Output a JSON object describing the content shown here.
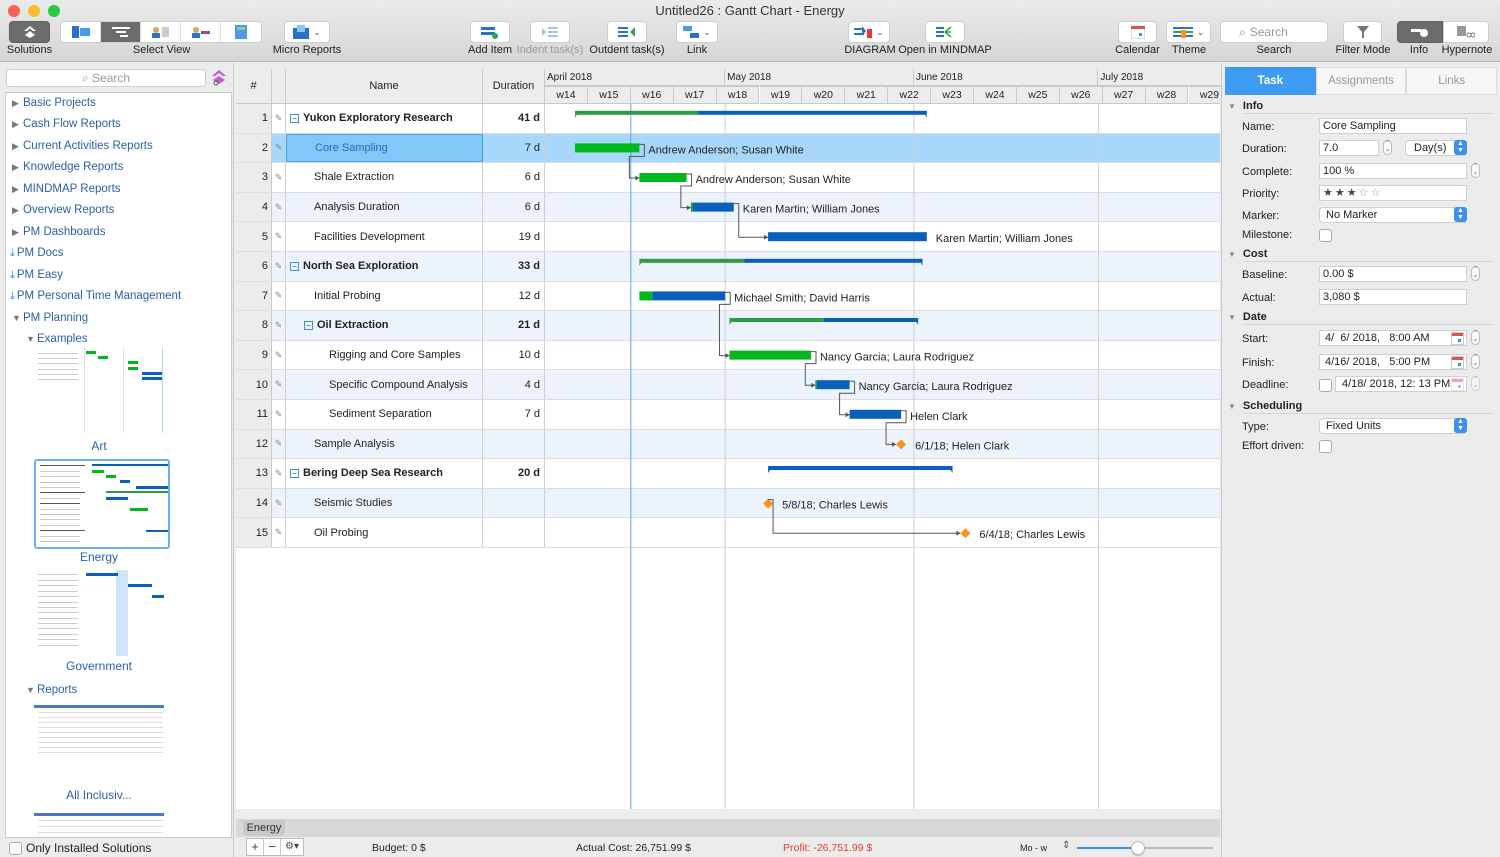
{
  "window": {
    "title": "Untitled26 : Gantt Chart - Energy"
  },
  "toolbar": {
    "solutions": "Solutions",
    "select_view": "Select View",
    "micro_reports": "Micro Reports",
    "add_item": "Add Item",
    "indent": "Indent task(s)",
    "outdent": "Outdent task(s)",
    "link": "Link",
    "diagram": "DIAGRAM",
    "open_mindmap": "Open in MINDMAP",
    "calendar": "Calendar",
    "theme": "Theme",
    "search_placeholder": "Search",
    "search_label": "Search",
    "filter_mode": "Filter Mode",
    "info": "Info",
    "hypernote": "Hypernote"
  },
  "sidebar": {
    "search_placeholder": "Search",
    "items": [
      {
        "label": "Basic Projects",
        "kind": "collapsed"
      },
      {
        "label": "Cash Flow Reports",
        "kind": "collapsed"
      },
      {
        "label": "Current Activities Reports",
        "kind": "collapsed"
      },
      {
        "label": "Knowledge Reports",
        "kind": "collapsed"
      },
      {
        "label": "MINDMAP Reports",
        "kind": "collapsed"
      },
      {
        "label": "Overview Reports",
        "kind": "collapsed"
      },
      {
        "label": "PM Dashboards",
        "kind": "collapsed"
      },
      {
        "label": "PM Docs",
        "kind": "download"
      },
      {
        "label": "PM Easy",
        "kind": "download"
      },
      {
        "label": "PM Personal Time Management",
        "kind": "download"
      },
      {
        "label": "PM Planning",
        "kind": "expanded"
      }
    ],
    "examples_label": "Examples",
    "reports_label": "Reports",
    "thumbnails": [
      "Art",
      "Energy",
      "Government"
    ],
    "report_thumbnails": [
      "All Inclusiv..."
    ],
    "only_installed": "Only Installed Solutions"
  },
  "grid": {
    "headers": {
      "num": "#",
      "name": "Name",
      "duration": "Duration"
    },
    "months": [
      "April 2018",
      "May 2018",
      "June 2018",
      "July 2018"
    ],
    "weeks": [
      "w14",
      "w15",
      "w16",
      "w17",
      "w18",
      "w19",
      "w20",
      "w21",
      "w22",
      "w23",
      "w24",
      "w25",
      "w26",
      "w27",
      "w28",
      "w29"
    ],
    "rows": [
      {
        "num": "1",
        "name": "Yukon Exploratory  Research",
        "duration": "41 d",
        "level": 0,
        "group": true
      },
      {
        "num": "2",
        "name": "Core Sampling",
        "duration": "7 d",
        "level": 1,
        "selected": true
      },
      {
        "num": "3",
        "name": "Shale Extraction",
        "duration": "6 d",
        "level": 1
      },
      {
        "num": "4",
        "name": "Analysis Duration",
        "duration": "6 d",
        "level": 1
      },
      {
        "num": "5",
        "name": "Facilities Development",
        "duration": "19 d",
        "level": 1
      },
      {
        "num": "6",
        "name": "North Sea Exploration",
        "duration": "33 d",
        "level": 0,
        "group": true
      },
      {
        "num": "7",
        "name": "Initial Probing",
        "duration": "12 d",
        "level": 1
      },
      {
        "num": "8",
        "name": "Oil  Extraction",
        "duration": "21 d",
        "level": 1,
        "group": true
      },
      {
        "num": "9",
        "name": "Rigging and Core Samples",
        "duration": "10 d",
        "level": 2
      },
      {
        "num": "10",
        "name": "Specific Compound Analysis",
        "duration": "4 d",
        "level": 2
      },
      {
        "num": "11",
        "name": "Sediment Separation",
        "duration": "7 d",
        "level": 2
      },
      {
        "num": "12",
        "name": "Sample Analysis",
        "duration": "",
        "level": 1
      },
      {
        "num": "13",
        "name": "Bering Deep Sea Research",
        "duration": "20 d",
        "level": 0,
        "group": true
      },
      {
        "num": "14",
        "name": "Seismic Studies",
        "duration": "",
        "level": 1
      },
      {
        "num": "15",
        "name": "Oil Probing",
        "duration": "",
        "level": 1
      }
    ]
  },
  "chart_data": {
    "type": "gantt",
    "x_unit": "week",
    "x_range": [
      "w14",
      "w29"
    ],
    "today_week": 16.0,
    "bars": [
      {
        "row": 1,
        "kind": "summary",
        "start": 14.7,
        "end": 22.9,
        "progress": 0.35,
        "label": ""
      },
      {
        "row": 2,
        "kind": "task",
        "start": 14.7,
        "end": 16.2,
        "progress": 1.0,
        "label": "Andrew Anderson; Susan White"
      },
      {
        "row": 3,
        "kind": "task",
        "start": 16.2,
        "end": 17.3,
        "progress": 1.0,
        "label": "Andrew Anderson; Susan White"
      },
      {
        "row": 4,
        "kind": "task",
        "start": 17.4,
        "end": 18.4,
        "progress": 0.05,
        "label": "Karen Martin; William Jones"
      },
      {
        "row": 5,
        "kind": "task",
        "start": 19.2,
        "end": 22.9,
        "progress": 0.0,
        "label": "Karen Martin; William Jones"
      },
      {
        "row": 6,
        "kind": "summary",
        "start": 16.2,
        "end": 22.8,
        "progress": 0.37,
        "label": ""
      },
      {
        "row": 7,
        "kind": "task",
        "start": 16.2,
        "end": 18.2,
        "progress": 0.15,
        "label": "Michael Smith; David Harris"
      },
      {
        "row": 8,
        "kind": "summary",
        "start": 18.3,
        "end": 22.7,
        "progress": 0.5,
        "label": ""
      },
      {
        "row": 9,
        "kind": "task",
        "start": 18.3,
        "end": 20.2,
        "progress": 1.0,
        "label": "Nancy Garcia; Laura Rodriguez"
      },
      {
        "row": 10,
        "kind": "task",
        "start": 20.3,
        "end": 21.1,
        "progress": 0.05,
        "label": "Nancy Garcia; Laura Rodriguez"
      },
      {
        "row": 11,
        "kind": "task",
        "start": 21.1,
        "end": 22.3,
        "progress": 0.0,
        "label": "Helen Clark"
      },
      {
        "row": 12,
        "kind": "milestone",
        "start": 22.3,
        "end": 22.3,
        "label": "6/1/18; Helen Clark"
      },
      {
        "row": 13,
        "kind": "summary",
        "start": 19.2,
        "end": 23.5,
        "progress": 0.0,
        "label": ""
      },
      {
        "row": 14,
        "kind": "milestone",
        "start": 19.2,
        "end": 19.2,
        "label": "5/8/18; Charles Lewis"
      },
      {
        "row": 15,
        "kind": "milestone",
        "start": 23.8,
        "end": 23.8,
        "label": "6/4/18; Charles Lewis"
      }
    ],
    "links": [
      [
        2,
        3
      ],
      [
        3,
        4
      ],
      [
        4,
        5
      ],
      [
        7,
        9
      ],
      [
        9,
        10
      ],
      [
        10,
        11
      ],
      [
        11,
        12
      ],
      [
        14,
        15
      ]
    ]
  },
  "panel": {
    "tabs": [
      "Task",
      "Assignments",
      "Links"
    ],
    "active_tab": "Task",
    "info": {
      "title": "Info",
      "name_label": "Name:",
      "name_value": "Core Sampling",
      "duration_label": "Duration:",
      "duration_value": "7.0",
      "duration_unit": "Day(s)",
      "complete_label": "Complete:",
      "complete_value": "100 %",
      "priority_label": "Priority:",
      "priority_stars": 3,
      "priority_max": 5,
      "marker_label": "Marker:",
      "marker_value": "No Marker",
      "milestone_label": "Milestone:",
      "milestone_checked": false
    },
    "cost": {
      "title": "Cost",
      "baseline_label": "Baseline:",
      "baseline_value": "0.00 $",
      "actual_label": "Actual:",
      "actual_value": "3,080 $"
    },
    "date": {
      "title": "Date",
      "start_label": "Start:",
      "start_value": "4/  6/ 2018,   8:00 AM",
      "finish_label": "Finish:",
      "finish_value": "4/16/ 2018,   5:00 PM",
      "deadline_label": "Deadline:",
      "deadline_value": "4/18/ 2018, 12: 13 PM"
    },
    "scheduling": {
      "title": "Scheduling",
      "type_label": "Type:",
      "type_value": "Fixed Units",
      "effort_label": "Effort driven:",
      "effort_checked": false
    }
  },
  "bottom": {
    "sheet_tab": "Energy",
    "budget": "Budget: 0 $",
    "actual_cost": "Actual Cost: 26,751.99 $",
    "profit": "Profit: -26,751.99 $",
    "scale": "Mo - w",
    "zoom_fraction": 0.45
  },
  "colors": {
    "accent": "#3d9cf1",
    "done": "#00b81c",
    "summary_done": "#2e9b48",
    "remaining": "#0a5fbd",
    "milestone": "#f7941d",
    "selected_row": "#a7d8fb",
    "alt_row": "#edf3fd",
    "profit_negative": "#e83b2e",
    "today_line": "#5aa8f0"
  }
}
